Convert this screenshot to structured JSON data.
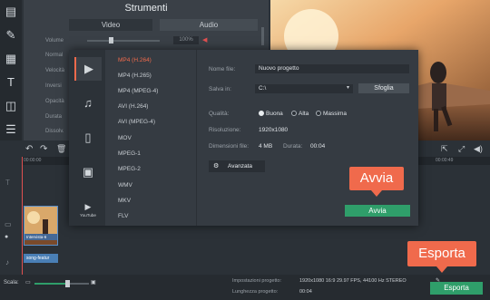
{
  "tools_panel": {
    "title": "Strumenti",
    "tabs": [
      "Video",
      "Audio"
    ],
    "labels": [
      "Volume",
      "Normal",
      "Velocità",
      "Inversi",
      "Opacità",
      "Durata",
      "Dissolv."
    ],
    "volume_percent": "100%"
  },
  "dialog": {
    "formats": [
      "MP4 (H.264)",
      "MP4 (H.265)",
      "MP4 (MPEG-4)",
      "AVI (H.264)",
      "AVI (MPEG-4)",
      "MOV",
      "MPEG-1",
      "MPEG-2",
      "WMV",
      "MKV",
      "FLV"
    ],
    "selected_format": "MP4 (H.264)",
    "youtube_label": "YouTube",
    "file_name_label": "Nome file:",
    "file_name_value": "Nuovo progetto",
    "save_in_label": "Salva in:",
    "save_in_value": "C:\\",
    "browse_label": "Sfoglia",
    "quality_label": "Qualità:",
    "quality_options": [
      "Buona",
      "Alta",
      "Massima"
    ],
    "quality_selected": "Buona",
    "resolution_label": "Risoluzione:",
    "resolution_value": "1920x1080",
    "file_size_label": "Dimensioni file:",
    "file_size_value": "4 MB",
    "duration_label": "Durata:",
    "duration_value": "00:04",
    "advanced_label": "Avanzata",
    "start_label": "Avvia"
  },
  "callouts": {
    "start": "Avvia",
    "export": "Esporta"
  },
  "timeline": {
    "time_start": "00:00:00",
    "time_end": "00:00:49",
    "clip_label": "Intervista-6",
    "audio_clip_label": "song-featur"
  },
  "status": {
    "scale_label": "Scala:",
    "project_settings_label": "Impostazioni progetto:",
    "project_settings_value": "1920x1080 16:9 29.97 FPS, 44100 Hz STEREO",
    "project_length_label": "Lunghezza progetto:",
    "project_length_value": "00:04",
    "export_label": "Esporta"
  },
  "colors": {
    "accent": "#f06a4c",
    "start_green": "#2f9e6a",
    "selected_format_red": "#f06a4c"
  }
}
